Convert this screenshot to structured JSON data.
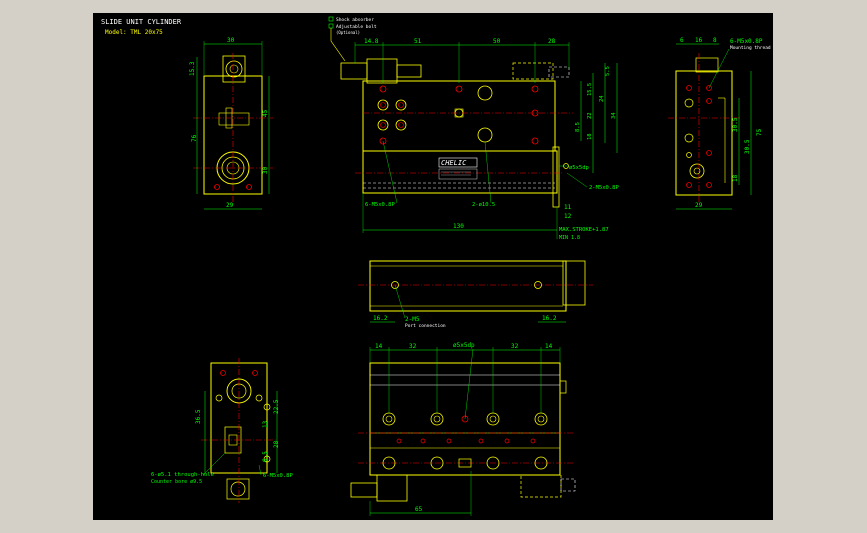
{
  "colors": {
    "background": "#000000",
    "outline": "#ffff00",
    "dimension": "#00ff00",
    "centerline": "#ff0000",
    "text": "#ffffff",
    "hidden": "#ffffff",
    "window": "#d4d0c8"
  },
  "title": {
    "line1": "SLIDE UNIT CYLINDER",
    "line2": "Model: TML 20x75"
  },
  "legend": {
    "item1": "Shock absorber",
    "item2": "Adjustable bolt",
    "item3": "(Optional)"
  },
  "brand": "CHELIC",
  "dims": {
    "side_top_30": "30",
    "side_left_15_3": "15.3",
    "side_left_76": "76",
    "side_45": "45",
    "side_30": "30",
    "side_bottom_29": "29",
    "front_14_8": "14.8",
    "front_51": "51",
    "front_50": "50",
    "front_28": "28",
    "front_130": "130",
    "front_5_5": "5.5",
    "front_15_5": "15.5",
    "front_24": "24",
    "front_22": "22",
    "front_34": "34",
    "front_18": "18",
    "front_8_5": "8.5",
    "front_11": "11",
    "front_12": "12",
    "front_phi5": "ø5x5dp",
    "front_m5": "2-M5x0.8P",
    "front_6m5": "6-M5x0.8P",
    "front_phi10": "2-ø10.5",
    "front_stroke": "MAX.STROKE+1.87",
    "front_min": "MIN  1.8",
    "right_6": "6",
    "right_16": "16",
    "right_8": "8",
    "right_m5": "6-M5x0.8P",
    "right_m5_sub": "Mounting thread",
    "right_30_5a": "30.5",
    "right_30_5b": "30.5",
    "right_75": "75",
    "right_18": "18",
    "right_29": "29",
    "mid_16_2a": "16.2",
    "mid_16_2b": "16.2",
    "mid_2m5": "2-M5",
    "mid_port": "Port connection",
    "bot_14a": "14",
    "bot_32a": "32",
    "bot_phi5": "ø5x5dp",
    "bot_32b": "32",
    "bot_14b": "14",
    "bot_65": "65",
    "end_36_5": "36.5",
    "end_22_5": "22.5",
    "end_28": "28",
    "end_13": "13",
    "end_6_5": "6.5",
    "end_note1": "6-ø5.1 through-hole",
    "end_note2": "Counter bore ø9.5",
    "end_m5": "6-M5x0.8P"
  }
}
